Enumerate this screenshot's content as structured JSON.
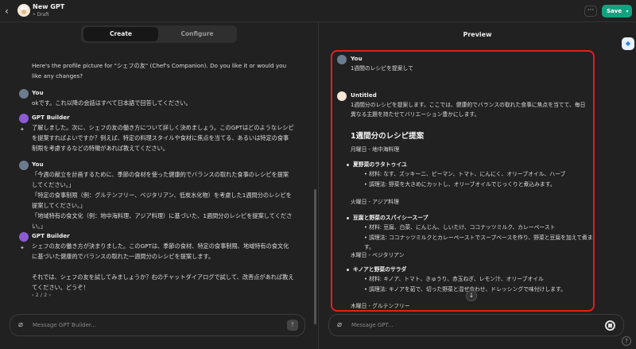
{
  "header": {
    "title": "New GPT",
    "status": "• Draft",
    "save_label": "Save",
    "more_label": "···"
  },
  "builder": {
    "tabs": [
      {
        "label": "Create"
      },
      {
        "label": "Configure"
      }
    ],
    "messages": [
      {
        "text": "Here's the profile picture for \"シェフの友\" (Chef's Companion). Do you like it or would you like any changes?"
      },
      {
        "author": "You",
        "text": "okです。これ以降の会話はすべて日本語で回答してください。"
      },
      {
        "author": "GPT Builder",
        "text": "了解しました。次に、シェフの友の働き方について詳しく決めましょう。このGPTはどのようなレシピを提案すればよいですか？例えば、特定の料理スタイルや食材に焦点を当てる、あるいは特定の食事制限を考慮するなどの特徴があれば教えてください。"
      },
      {
        "author": "You",
        "text": "「今週の献立を計画するために、季節の食材を使った健康的でバランスの取れた食事のレシピを提案してください。」\n「特定の食事制限（例：グルテンフリー、ベジタリアン、低炭水化物）を考慮した1週間分のレシピを提案してください。」\n「地域特有の食文化（例：地中海料理、アジア料理）に基づいた、1週間分のレシピを提案してください。」"
      },
      {
        "author": "GPT Builder",
        "text": "シェフの友の働き方が決まりました。このGPTは、季節の食材、特定の食事制限、地域特有の食文化に基づいた健康的でバランスの取れた一週間分のレシピを提案します。\n\nそれでは、シェフの友を試してみましょうか？右のチャットダイアログで試して、改善点があれば教えてください。どうぞ！"
      }
    ],
    "pager": "‹  2 / 2  ›",
    "input_placeholder": "Message GPT Builder..."
  },
  "preview": {
    "title": "Preview",
    "user": {
      "author": "You",
      "text": "1週間のレシピを提案して"
    },
    "assistant": {
      "author": "Untitled",
      "intro": "1週間分のレシピを提案します。ここでは、健康的でバランスの取れた食事に焦点を当てて、毎日異なる主題を持たせてバリエーション豊かにします。",
      "heading": "1週間分のレシピ提案",
      "days": [
        {
          "day": "月曜日 - 地中海料理",
          "dish": "夏野菜のラタトゥイユ",
          "ingredients": "材料: なす、ズッキーニ、ピーマン、トマト、にんにく、オリーブオイル、ハーブ",
          "method": "調理法: 野菜を大きめにカットし、オリーブオイルでじっくりと煮込みます。"
        },
        {
          "day": "火曜日 - アジア料理",
          "dish": "豆腐と野菜のスパイシースープ",
          "ingredients": "材料: 豆腐、白菜、にんじん、しいたけ、ココナッツミルク、カレーペースト",
          "method": "調理法: ココナッツミルクとカレーペーストでスープベースを作り、野菜と豆腐を加えて煮ます。"
        },
        {
          "day": "水曜日 - ベジタリアン",
          "dish": "キノアと野菜のサラダ",
          "ingredients": "材料: キノア、トマト、きゅうり、赤玉ねぎ、レモン汁、オリーブオイル",
          "method": "調理法: キノアを茹で、切った野菜と混ぜ合わせ、ドレッシングで味付けします。"
        },
        {
          "day": "木曜日 - グルテンフリー"
        }
      ]
    },
    "input_placeholder": "Message GPT..."
  },
  "icons": {
    "back": "chevron-left-icon",
    "avatar": "chef-avatar-icon",
    "attach": "paperclip-icon",
    "send": "arrow-up-icon",
    "down": "arrow-down-icon",
    "stop": "stop-icon",
    "help": "question-icon"
  },
  "colors": {
    "accent": "#10a37f",
    "highlight": "#e02020",
    "gpt_avatar": "#8e5ad6"
  }
}
